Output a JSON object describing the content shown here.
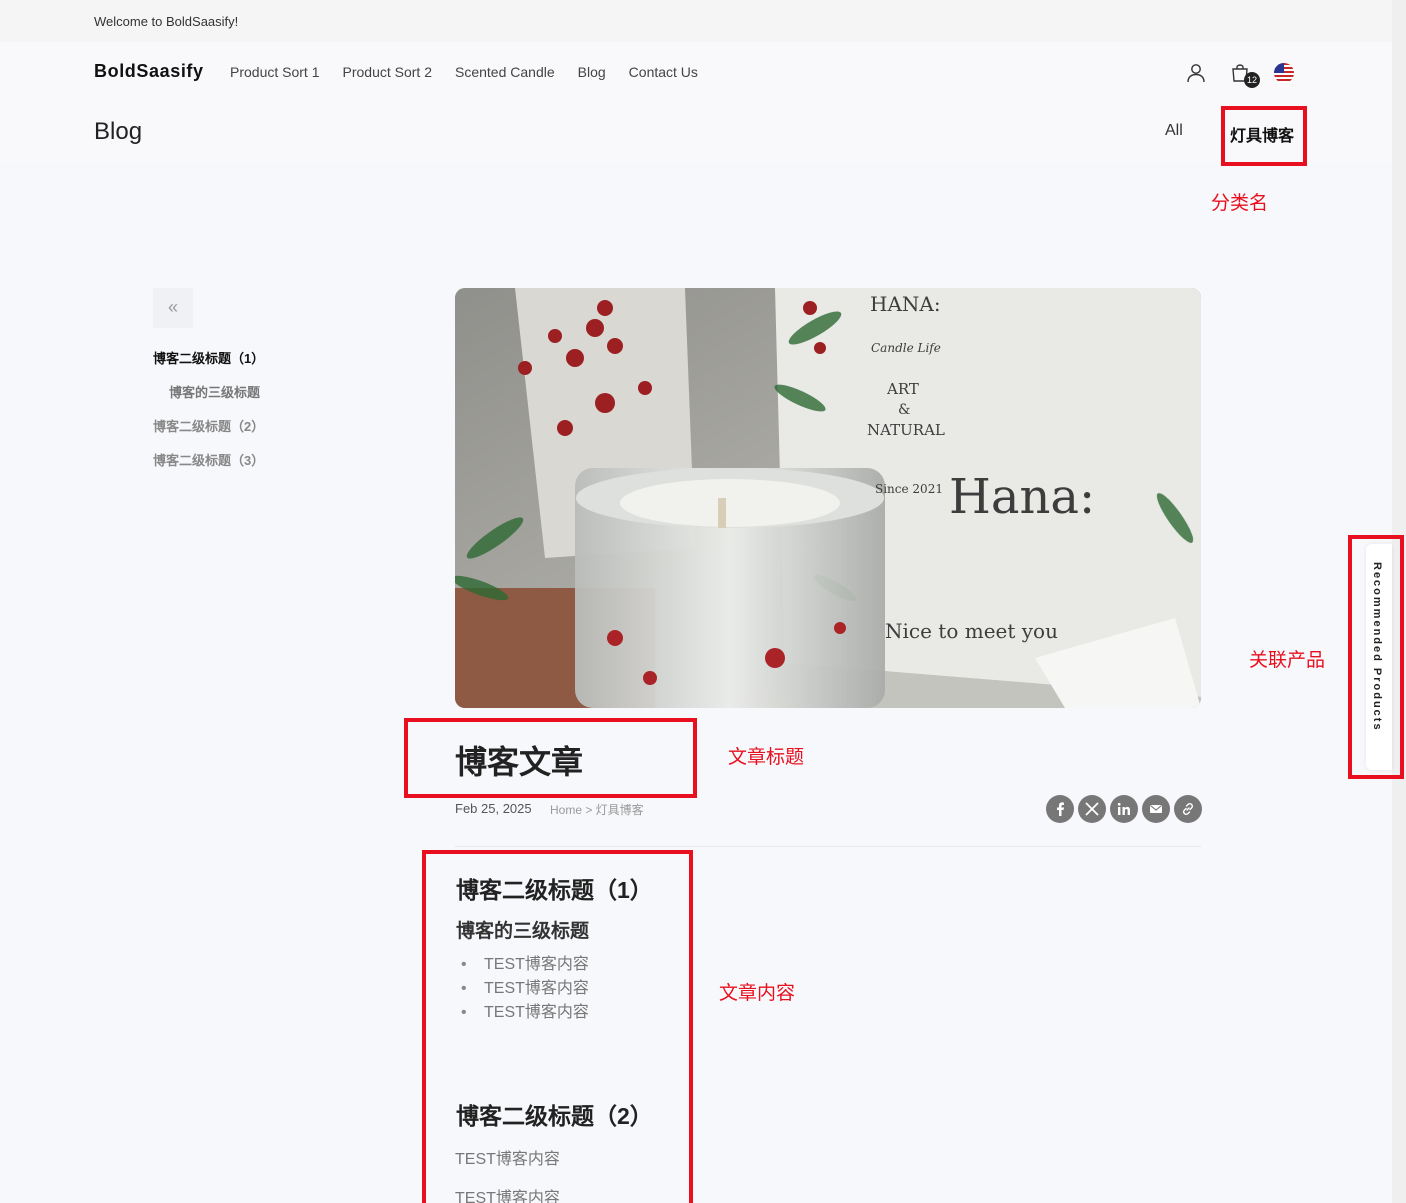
{
  "topbar": {
    "welcome": "Welcome to BoldSaasify!"
  },
  "header": {
    "logo": "BoldSaasify",
    "nav": [
      "Product Sort 1",
      "Product Sort 2",
      "Scented Candle",
      "Blog",
      "Contact Us"
    ],
    "cart_count": "12",
    "icons": [
      "user-icon",
      "cart-icon",
      "us-flag-icon"
    ]
  },
  "blog": {
    "title": "Blog",
    "categories": {
      "all": "All",
      "active": "灯具博客"
    }
  },
  "toc": {
    "items": [
      "博客二级标题（1）",
      "博客的三级标题",
      "博客二级标题（2）",
      "博客二级标题（3）"
    ]
  },
  "hero": {
    "box_lines": [
      "HANA:",
      "Candle Life",
      "ART",
      "&",
      "NATURAL",
      "Since 2021",
      "Hana:",
      "Nice to meet you"
    ]
  },
  "article": {
    "title": "博客文章",
    "date": "Feb 25, 2025",
    "breadcrumb": "Home > 灯具博客",
    "share": [
      "facebook-icon",
      "x-icon",
      "linkedin-icon",
      "email-icon",
      "link-icon"
    ],
    "h2_1": "博客二级标题（1）",
    "h3_1": "博客的三级标题",
    "list": [
      "TEST博客内容",
      "TEST博客内容",
      "TEST博客内容"
    ],
    "h2_2": "博客二级标题（2）",
    "p1": "TEST博客内容",
    "p2": "TEST博客内容"
  },
  "recommended": {
    "label": "Recommended Products"
  },
  "annotations": {
    "category": "分类名",
    "related": "关联产品",
    "title": "文章标题",
    "content": "文章内容"
  },
  "colors": {
    "annotation": "#e8101e",
    "background": "#f7f8fb"
  }
}
